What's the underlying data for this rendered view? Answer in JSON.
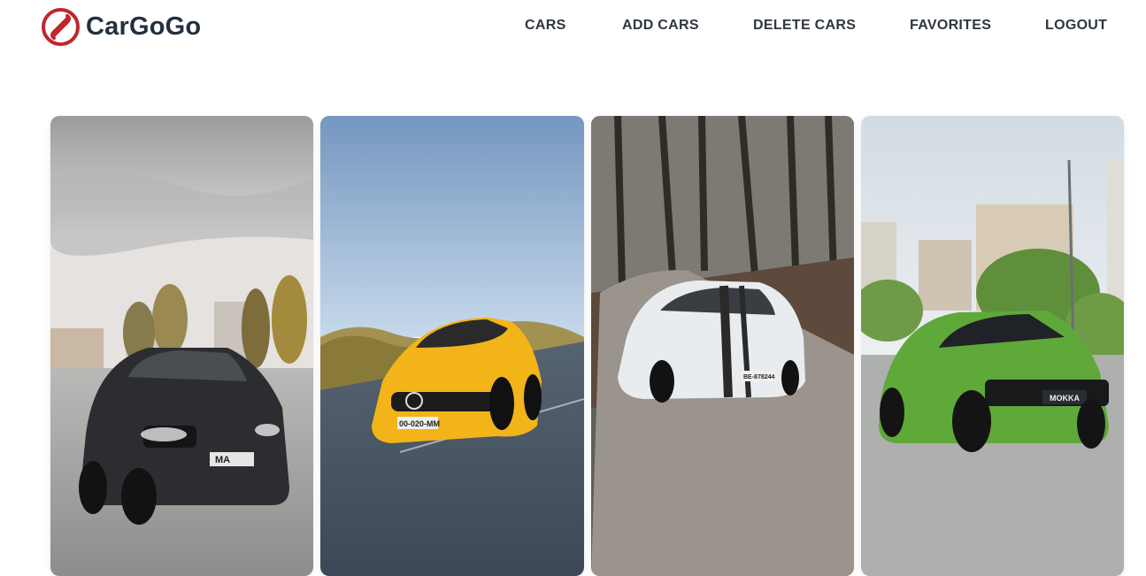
{
  "brand": {
    "name": "CarGoGo",
    "accent": "#c0262d",
    "text_color": "#22313f"
  },
  "nav": {
    "items": [
      {
        "id": "cars",
        "label": "CARS"
      },
      {
        "id": "add-cars",
        "label": "ADD CARS"
      },
      {
        "id": "delete-cars",
        "label": "DELETE CARS"
      },
      {
        "id": "favorites",
        "label": "FAVORITES"
      },
      {
        "id": "logout",
        "label": "LOGOUT"
      }
    ]
  },
  "cars": [
    {
      "plate": "MA",
      "color": "#2b2d30",
      "scene": "parking-lot"
    },
    {
      "plate": "00-020-MM",
      "color": "#f2b418",
      "scene": "highway"
    },
    {
      "plate": "BE-878244",
      "color": "#e9ecee",
      "scene": "forest-road"
    },
    {
      "plate": "MOKKA",
      "color": "#5fa83a",
      "scene": "city-road"
    }
  ]
}
